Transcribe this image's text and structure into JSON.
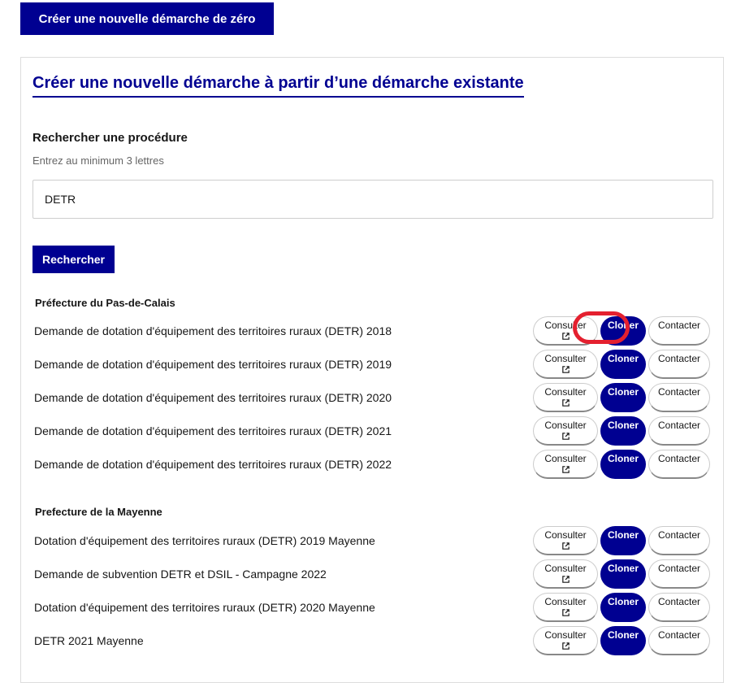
{
  "create_scratch_label": "Créer une nouvelle démarche de zéro",
  "clone_section": {
    "title": "Créer une nouvelle démarche à partir d’une démarche existante",
    "search_label": "Rechercher une procédure",
    "search_hint": "Entrez au minimum 3 lettres",
    "search_value": "DETR",
    "search_button": "Rechercher"
  },
  "actions": {
    "consult": "Consulter",
    "clone": "Cloner",
    "contact": "Contacter"
  },
  "groups": [
    {
      "title": "Préfecture du Pas-de-Calais",
      "items": [
        "Demande de dotation d'équipement des territoires ruraux (DETR) 2018",
        "Demande de dotation d'équipement des territoires ruraux (DETR) 2019",
        "Demande de dotation d'équipement des territoires ruraux (DETR) 2020",
        "Demande de dotation d'équipement des territoires ruraux (DETR) 2021",
        "Demande de dotation d'équipement des territoires ruraux (DETR) 2022"
      ]
    },
    {
      "title": "Prefecture de la Mayenne",
      "items": [
        "Dotation d'équipement des territoires ruraux (DETR) 2019 Mayenne",
        "Demande de subvention DETR et DSIL - Campagne 2022",
        "Dotation d'équipement des territoires ruraux (DETR) 2020 Mayenne",
        "DETR 2021 Mayenne"
      ]
    }
  ],
  "colors": {
    "primary": "#000091",
    "highlight": "#e4202f"
  },
  "icons": {
    "external_link": "external-link-icon"
  }
}
